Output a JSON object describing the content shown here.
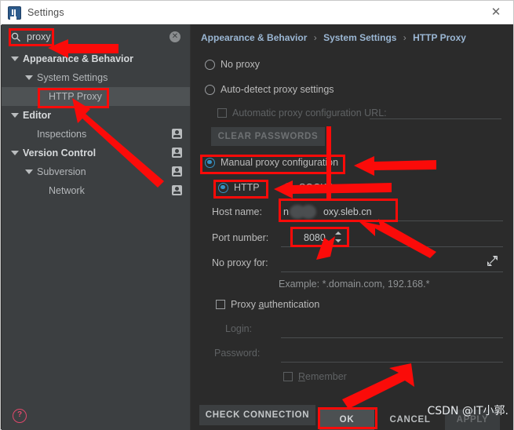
{
  "window": {
    "title": "Settings",
    "app_icon": "intellij-idea-icon",
    "close_icon": "close-icon"
  },
  "sidebar": {
    "search": {
      "value": "proxy",
      "icon": "search-icon",
      "clear_icon": "clear-icon"
    },
    "tree": [
      {
        "label": "Appearance & Behavior",
        "indent": 0,
        "twisty": true,
        "bold": true,
        "selected": false,
        "badge": false
      },
      {
        "label": "System Settings",
        "indent": 1,
        "twisty": true,
        "bold": false,
        "selected": false,
        "badge": false
      },
      {
        "label": "HTTP Proxy",
        "indent": 2,
        "twisty": false,
        "bold": false,
        "selected": true,
        "badge": false
      },
      {
        "label": "Editor",
        "indent": 0,
        "twisty": true,
        "bold": true,
        "selected": false,
        "badge": false
      },
      {
        "label": "Inspections",
        "indent": 1,
        "twisty": false,
        "bold": false,
        "selected": false,
        "badge": true
      },
      {
        "label": "Version Control",
        "indent": 0,
        "twisty": true,
        "bold": true,
        "selected": false,
        "badge": true
      },
      {
        "label": "Subversion",
        "indent": 1,
        "twisty": true,
        "bold": false,
        "selected": false,
        "badge": true
      },
      {
        "label": "Network",
        "indent": 2,
        "twisty": false,
        "bold": false,
        "selected": false,
        "badge": true
      }
    ],
    "help_icon": "help-icon"
  },
  "main": {
    "breadcrumb": {
      "part1": "Appearance & Behavior",
      "part2": "System Settings",
      "part3": "HTTP Proxy",
      "separator": "›"
    },
    "no_proxy": {
      "label": "No proxy",
      "selected": false
    },
    "auto_detect": {
      "label": "Auto-detect proxy settings",
      "selected": false
    },
    "auto_config_url": {
      "label": "Automatic proxy configuration URL:",
      "checked": false,
      "value": ""
    },
    "clear_passwords": {
      "label": "CLEAR PASSWORDS",
      "enabled": false
    },
    "manual": {
      "label": "Manual proxy configuration",
      "selected": true
    },
    "http": {
      "label": "HTTP",
      "selected": true
    },
    "socks": {
      "label": "SOCKS",
      "selected": false
    },
    "host_name": {
      "label": "Host name:",
      "value": "n███oxy.sleb.cn",
      "value_prefix": "n",
      "value_suffix": "oxy.sleb.cn"
    },
    "port_number": {
      "label": "Port number:",
      "value": "8080",
      "spinner_icon": "spinner-updown-icon"
    },
    "no_proxy_for": {
      "label": "No proxy for:",
      "value": "",
      "expand_icon": "expand-icon"
    },
    "example_hint": "Example: *.domain.com, 192.168.*",
    "proxy_auth": {
      "label_pre": "Proxy ",
      "label_mnemonic": "a",
      "label_post": "uthentication",
      "checked": false
    },
    "login": {
      "label": "Login:",
      "value": ""
    },
    "password": {
      "label": "Password:",
      "value": ""
    },
    "remember": {
      "label_mnemonic": "R",
      "label_post": "emember",
      "checked": false
    },
    "check_connection": {
      "label": "CHECK CONNECTION",
      "enabled": true
    }
  },
  "dialog_buttons": {
    "ok": "OK",
    "cancel": "CANCEL",
    "apply": "APPLY"
  },
  "annotations": {
    "color": "#fb0b09",
    "boxes": [
      "search-field",
      "http-proxy-tree-item",
      "manual-proxy-radio",
      "http-radio",
      "host-name-field",
      "port-number-field",
      "ok-button"
    ],
    "arrows": 6
  },
  "watermark": "CSDN @IT小郭."
}
